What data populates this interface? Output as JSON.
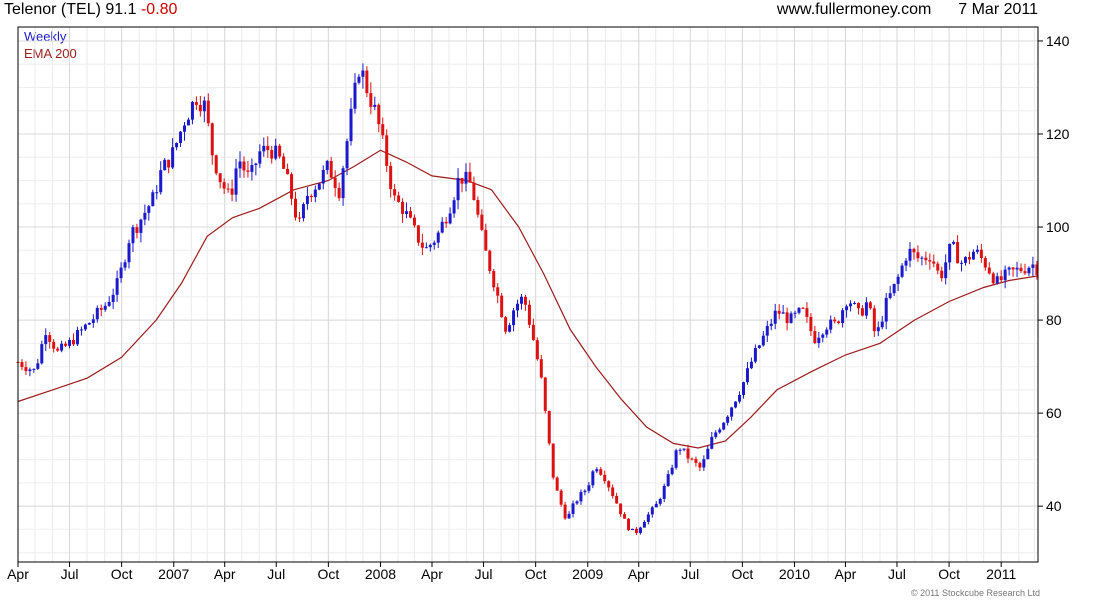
{
  "header": {
    "symbol_text": "Telenor (TEL) 91.1",
    "change_text": "-0.80",
    "site": "www.fullermoney.com",
    "date": "7 Mar 2011"
  },
  "legend": {
    "weekly": "Weekly",
    "ema": "EMA 200"
  },
  "footer": {
    "copyright": "© 2011 Stockcube Research Ltd"
  },
  "colors": {
    "up": "#1a1acc",
    "down": "#dd1111",
    "ema": "#9b1c1c",
    "grid": "#d9d9d9",
    "change": "#cc0000"
  },
  "chart_data": {
    "type": "line",
    "title": "Telenor (TEL) 91.1 -0.80",
    "ylim": [
      28,
      143
    ],
    "y_ticks": [
      40,
      60,
      80,
      100,
      120,
      140
    ],
    "x_range": [
      "2006-04-01",
      "2011-03-07"
    ],
    "x_ticks": [
      {
        "date": "2006-04-01",
        "label": "Apr"
      },
      {
        "date": "2006-07-01",
        "label": "Jul"
      },
      {
        "date": "2006-10-01",
        "label": "Oct"
      },
      {
        "date": "2007-01-01",
        "label": "2007"
      },
      {
        "date": "2007-04-01",
        "label": "Apr"
      },
      {
        "date": "2007-07-01",
        "label": "Jul"
      },
      {
        "date": "2007-10-01",
        "label": "Oct"
      },
      {
        "date": "2008-01-01",
        "label": "2008"
      },
      {
        "date": "2008-04-01",
        "label": "Apr"
      },
      {
        "date": "2008-07-01",
        "label": "Jul"
      },
      {
        "date": "2008-10-01",
        "label": "Oct"
      },
      {
        "date": "2009-01-01",
        "label": "2009"
      },
      {
        "date": "2009-04-01",
        "label": "Apr"
      },
      {
        "date": "2009-07-01",
        "label": "Jul"
      },
      {
        "date": "2009-10-01",
        "label": "Oct"
      },
      {
        "date": "2010-01-01",
        "label": "2010"
      },
      {
        "date": "2010-04-01",
        "label": "Apr"
      },
      {
        "date": "2010-07-01",
        "label": "Jul"
      },
      {
        "date": "2010-10-01",
        "label": "Oct"
      },
      {
        "date": "2011-01-01",
        "label": "2011"
      }
    ],
    "grid": true,
    "series": [
      {
        "name": "Weekly",
        "points": [
          [
            "2006-04-01",
            71
          ],
          [
            "2006-05-01",
            69
          ],
          [
            "2006-05-20",
            78
          ],
          [
            "2006-06-10",
            73
          ],
          [
            "2006-07-01",
            75
          ],
          [
            "2006-08-01",
            79
          ],
          [
            "2006-09-01",
            83
          ],
          [
            "2006-09-25",
            88
          ],
          [
            "2006-10-15",
            98
          ],
          [
            "2006-11-05",
            102
          ],
          [
            "2006-11-25",
            106
          ],
          [
            "2006-12-10",
            112
          ],
          [
            "2006-12-31",
            116
          ],
          [
            "2007-01-20",
            123
          ],
          [
            "2007-02-10",
            128
          ],
          [
            "2007-02-25",
            126
          ],
          [
            "2007-03-10",
            116
          ],
          [
            "2007-03-25",
            110
          ],
          [
            "2007-04-10",
            106
          ],
          [
            "2007-04-25",
            115
          ],
          [
            "2007-05-15",
            110
          ],
          [
            "2007-06-01",
            116
          ],
          [
            "2007-06-20",
            117
          ],
          [
            "2007-07-10",
            114
          ],
          [
            "2007-07-25",
            108
          ],
          [
            "2007-08-10",
            100
          ],
          [
            "2007-08-25",
            107
          ],
          [
            "2007-09-15",
            110
          ],
          [
            "2007-10-01",
            113
          ],
          [
            "2007-10-20",
            108
          ],
          [
            "2007-11-05",
            120
          ],
          [
            "2007-11-25",
            135
          ],
          [
            "2007-12-10",
            129
          ],
          [
            "2007-12-25",
            124
          ],
          [
            "2008-01-10",
            115
          ],
          [
            "2008-01-25",
            106
          ],
          [
            "2008-02-10",
            104
          ],
          [
            "2008-03-01",
            99
          ],
          [
            "2008-03-20",
            95
          ],
          [
            "2008-04-10",
            98
          ],
          [
            "2008-05-01",
            104
          ],
          [
            "2008-05-20",
            111
          ],
          [
            "2008-06-10",
            109
          ],
          [
            "2008-07-01",
            96
          ],
          [
            "2008-07-20",
            88
          ],
          [
            "2008-08-10",
            78
          ],
          [
            "2008-08-25",
            83
          ],
          [
            "2008-09-10",
            85
          ],
          [
            "2008-09-25",
            77
          ],
          [
            "2008-10-10",
            68
          ],
          [
            "2008-10-20",
            58
          ],
          [
            "2008-10-31",
            47
          ],
          [
            "2008-11-10",
            42
          ],
          [
            "2008-11-25",
            37
          ],
          [
            "2008-12-10",
            41
          ],
          [
            "2008-12-31",
            44
          ],
          [
            "2009-01-15",
            49
          ],
          [
            "2009-02-01",
            46
          ],
          [
            "2009-02-20",
            41
          ],
          [
            "2009-03-10",
            36
          ],
          [
            "2009-03-25",
            34
          ],
          [
            "2009-04-10",
            37
          ],
          [
            "2009-05-01",
            40
          ],
          [
            "2009-05-20",
            45
          ],
          [
            "2009-06-10",
            53
          ],
          [
            "2009-07-01",
            50
          ],
          [
            "2009-07-20",
            48
          ],
          [
            "2009-08-10",
            55
          ],
          [
            "2009-09-01",
            59
          ],
          [
            "2009-10-01",
            66
          ],
          [
            "2009-10-20",
            72
          ],
          [
            "2009-11-10",
            77
          ],
          [
            "2009-12-01",
            82
          ],
          [
            "2009-12-25",
            80
          ],
          [
            "2010-01-15",
            82
          ],
          [
            "2010-02-05",
            76
          ],
          [
            "2010-02-25",
            79
          ],
          [
            "2010-03-15",
            79
          ],
          [
            "2010-04-05",
            85
          ],
          [
            "2010-04-25",
            81
          ],
          [
            "2010-05-10",
            84
          ],
          [
            "2010-05-25",
            76
          ],
          [
            "2010-06-10",
            83
          ],
          [
            "2010-06-30",
            88
          ],
          [
            "2010-07-20",
            95
          ],
          [
            "2010-08-10",
            93
          ],
          [
            "2010-08-30",
            94
          ],
          [
            "2010-09-15",
            89
          ],
          [
            "2010-10-05",
            96
          ],
          [
            "2010-10-25",
            92
          ],
          [
            "2010-11-15",
            95
          ],
          [
            "2010-12-05",
            92
          ],
          [
            "2010-12-25",
            88
          ],
          [
            "2011-01-15",
            90
          ],
          [
            "2011-02-05",
            91
          ],
          [
            "2011-02-25",
            92
          ],
          [
            "2011-03-07",
            91.1
          ]
        ]
      },
      {
        "name": "EMA 200",
        "points": [
          [
            "2006-04-01",
            62.5
          ],
          [
            "2006-06-01",
            65
          ],
          [
            "2006-08-01",
            67.5
          ],
          [
            "2006-10-01",
            72
          ],
          [
            "2006-12-01",
            80
          ],
          [
            "2007-01-15",
            88
          ],
          [
            "2007-03-01",
            98
          ],
          [
            "2007-04-15",
            102
          ],
          [
            "2007-06-01",
            104
          ],
          [
            "2007-08-01",
            108
          ],
          [
            "2007-10-01",
            110
          ],
          [
            "2007-11-15",
            113
          ],
          [
            "2008-01-01",
            116.5
          ],
          [
            "2008-02-15",
            114
          ],
          [
            "2008-04-01",
            111
          ],
          [
            "2008-06-01",
            110
          ],
          [
            "2008-07-15",
            108
          ],
          [
            "2008-09-01",
            100
          ],
          [
            "2008-10-15",
            90
          ],
          [
            "2008-12-01",
            78
          ],
          [
            "2009-01-15",
            70
          ],
          [
            "2009-03-01",
            63
          ],
          [
            "2009-04-15",
            57
          ],
          [
            "2009-06-01",
            53.5
          ],
          [
            "2009-07-15",
            52.5
          ],
          [
            "2009-09-01",
            54
          ],
          [
            "2009-10-15",
            59
          ],
          [
            "2009-12-01",
            65
          ],
          [
            "2010-02-01",
            69
          ],
          [
            "2010-04-01",
            72.5
          ],
          [
            "2010-06-01",
            75
          ],
          [
            "2010-08-01",
            80
          ],
          [
            "2010-10-01",
            84
          ],
          [
            "2010-12-01",
            87
          ],
          [
            "2011-01-15",
            88.5
          ],
          [
            "2011-03-07",
            89.5
          ]
        ]
      }
    ]
  }
}
